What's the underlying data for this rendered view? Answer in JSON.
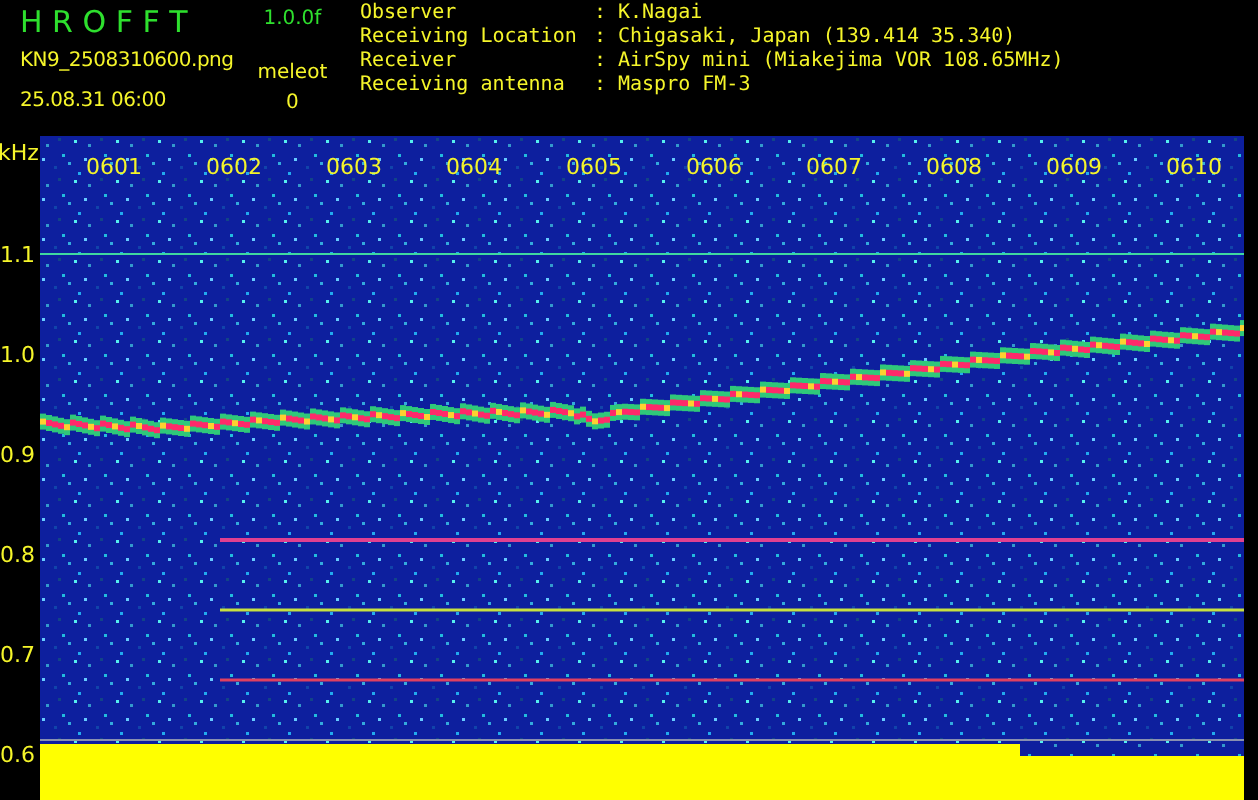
{
  "header": {
    "title": "H R O F F T",
    "version": "1.0.0f",
    "filename": "KN9_2508310600.png",
    "datetime": "25.08.31 06:00",
    "counter_label": "meleot",
    "counter_value": "0"
  },
  "info": [
    {
      "label": "Observer",
      "separator": ":",
      "value": "K.Nagai"
    },
    {
      "label": "Receiving Location",
      "separator": ":",
      "value": "Chigasaki, Japan (139.414 35.340)"
    },
    {
      "label": "Receiver",
      "separator": ":",
      "value": "AirSpy mini (Miakejima VOR 108.65MHz)"
    },
    {
      "label": "Receiving antenna",
      "separator": ":",
      "value": "Maspro FM-3"
    }
  ],
  "spectrogram": {
    "unit": "kHz",
    "frequency_labels": [
      "1.1",
      "1.0",
      "0.9",
      "0.8",
      "0.7",
      "0.6"
    ],
    "time_labels": [
      "0601",
      "0602",
      "0603",
      "0604",
      "0605",
      "0606",
      "0607",
      "0608",
      "0609",
      "0610"
    ]
  }
}
